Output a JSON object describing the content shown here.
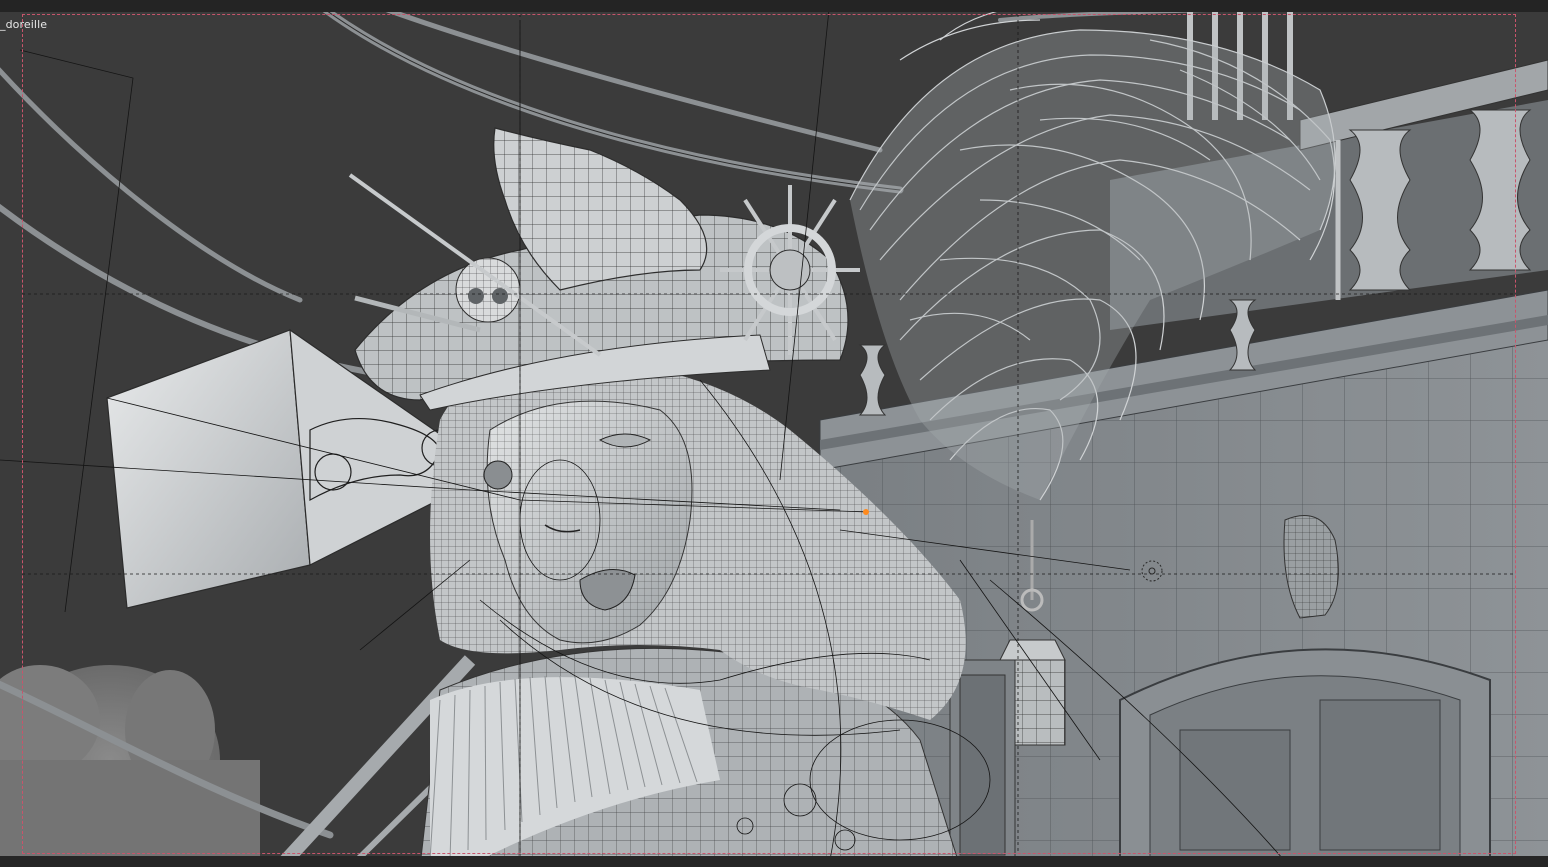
{
  "viewport": {
    "camera_name": "_doreille",
    "shading": "solid-wireframe-overlay",
    "colors": {
      "background": "#3b3b3b",
      "mesh_light": "#d8dadb",
      "mesh_mid": "#9aa0a4",
      "mesh_dark": "#5e6468",
      "wire": "#1e1e1e",
      "passepartout_border": "#c9546b",
      "selected_origin": "#ff8a1d"
    }
  }
}
